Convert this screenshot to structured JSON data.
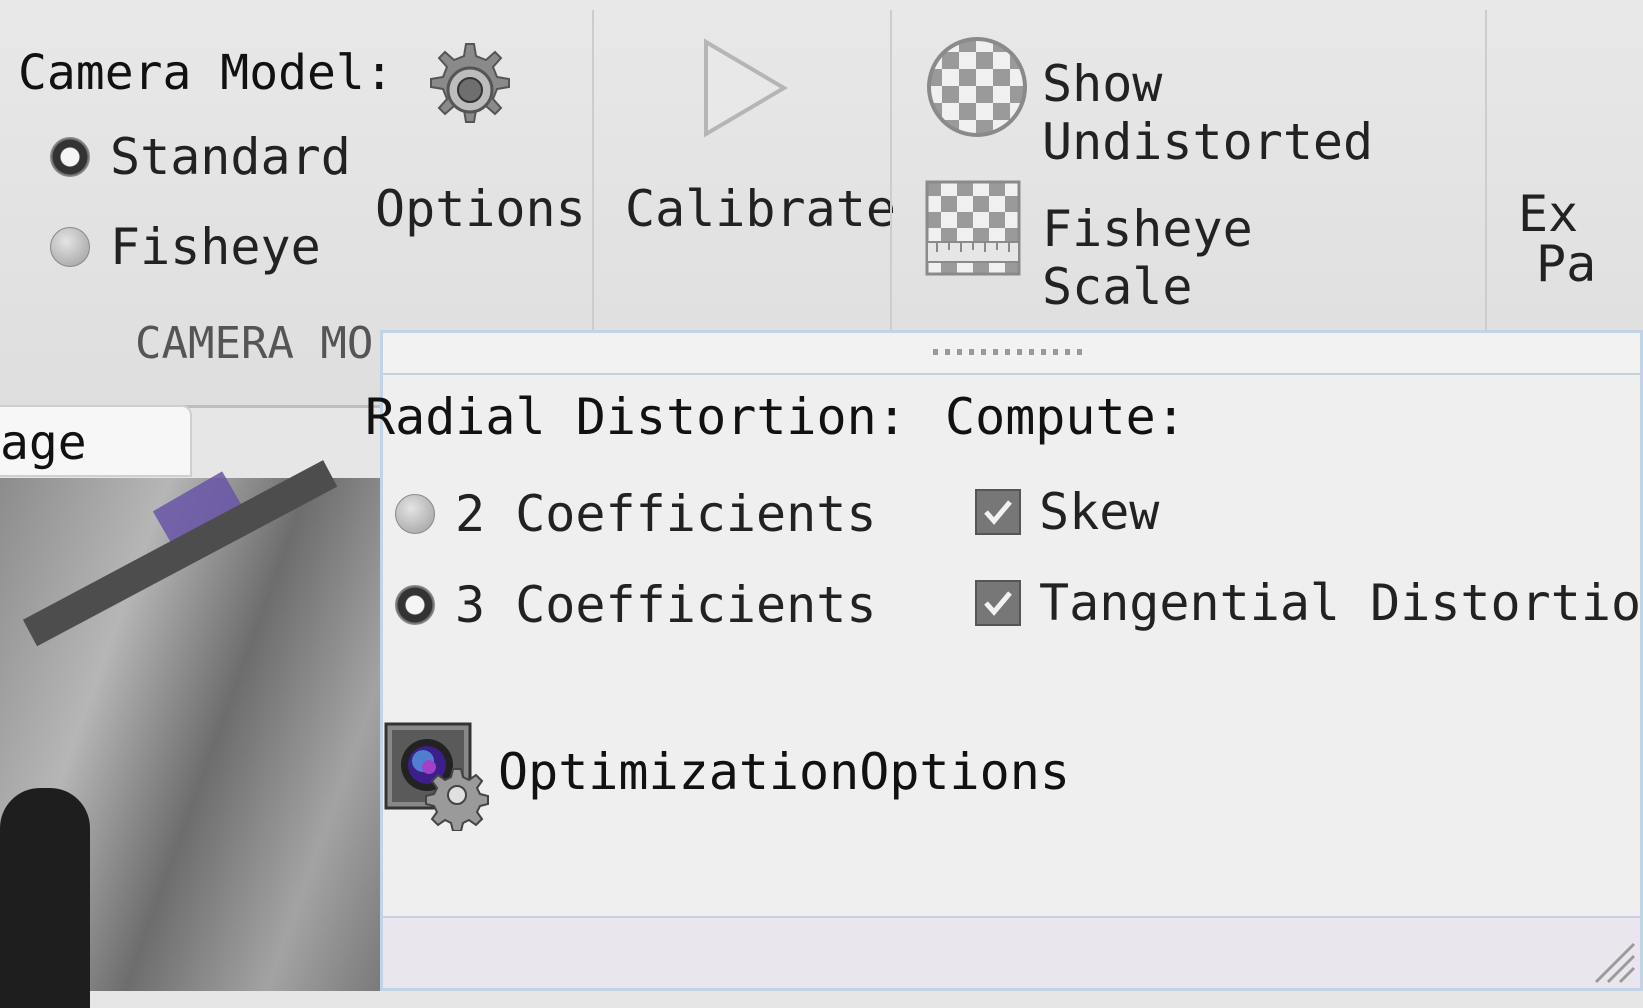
{
  "toolstrip": {
    "camera_model": {
      "label": "Camera Model:",
      "options": [
        {
          "label": "Standard",
          "selected": true
        },
        {
          "label": "Fisheye",
          "selected": false
        }
      ],
      "section_title": "CAMERA MO"
    },
    "options_button": {
      "label": "Options",
      "icon": "gear-icon"
    },
    "calibrate_button": {
      "label": "Calibrate",
      "icon": "play-icon"
    },
    "show_undistorted": {
      "label": "Show Undistorted",
      "icon": "checkerboard-ball-icon"
    },
    "fisheye_scale": {
      "label": "Fisheye Scale",
      "icon": "checkerboard-scale-icon"
    },
    "export": {
      "line1": "Ex",
      "line2": "Pa"
    }
  },
  "document_tab": {
    "label": "age"
  },
  "popup": {
    "radial_distortion": {
      "label": "Radial Distortion:",
      "options": [
        {
          "label": "2 Coefficients",
          "selected": false
        },
        {
          "label": "3 Coefficients",
          "selected": true
        }
      ]
    },
    "compute": {
      "label": "Compute:",
      "options": [
        {
          "label": "Skew",
          "checked": true
        },
        {
          "label": "Tangential Distortion",
          "checked": true
        }
      ]
    },
    "optimization_options": {
      "label": "OptimizationOptions",
      "icon": "camera-gear-icon"
    }
  }
}
